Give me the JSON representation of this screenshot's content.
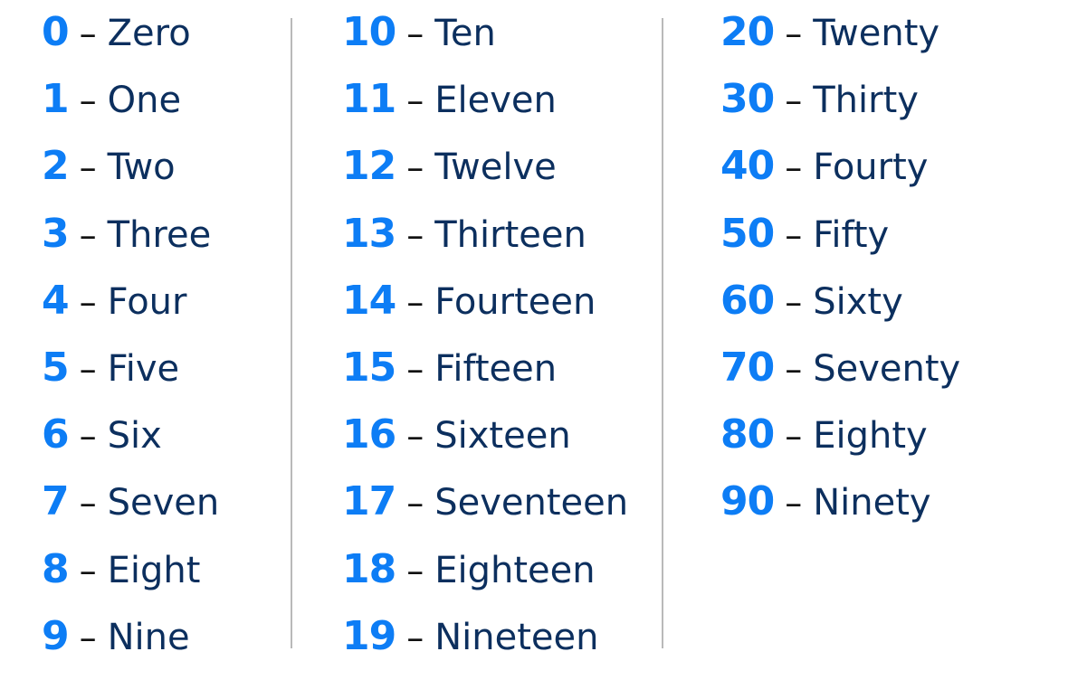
{
  "columns": [
    {
      "items": [
        {
          "num": "0",
          "word": "Zero"
        },
        {
          "num": "1",
          "word": "One"
        },
        {
          "num": "2",
          "word": "Two"
        },
        {
          "num": "3",
          "word": "Three"
        },
        {
          "num": "4",
          "word": "Four"
        },
        {
          "num": "5",
          "word": "Five"
        },
        {
          "num": "6",
          "word": "Six"
        },
        {
          "num": "7",
          "word": "Seven"
        },
        {
          "num": "8",
          "word": "Eight"
        },
        {
          "num": "9",
          "word": "Nine"
        }
      ]
    },
    {
      "items": [
        {
          "num": "10",
          "word": "Ten"
        },
        {
          "num": "11",
          "word": "Eleven"
        },
        {
          "num": "12",
          "word": "Twelve"
        },
        {
          "num": "13",
          "word": "Thirteen"
        },
        {
          "num": "14",
          "word": "Fourteen"
        },
        {
          "num": "15",
          "word": "Fifteen"
        },
        {
          "num": "16",
          "word": "Sixteen"
        },
        {
          "num": "17",
          "word": "Seventeen"
        },
        {
          "num": "18",
          "word": "Eighteen"
        },
        {
          "num": "19",
          "word": "Nineteen"
        }
      ]
    },
    {
      "items": [
        {
          "num": "20",
          "word": "Twenty"
        },
        {
          "num": "30",
          "word": "Thirty"
        },
        {
          "num": "40",
          "word": "Fourty"
        },
        {
          "num": "50",
          "word": "Fifty"
        },
        {
          "num": "60",
          "word": "Sixty"
        },
        {
          "num": "70",
          "word": "Seventy"
        },
        {
          "num": "80",
          "word": "Eighty"
        },
        {
          "num": "90",
          "word": "Ninety"
        }
      ]
    }
  ],
  "separator": "–",
  "colors": {
    "number": "#0d7df5",
    "word": "#0c2f5e",
    "dash": "#111111",
    "divider": "#b9b9b9"
  }
}
